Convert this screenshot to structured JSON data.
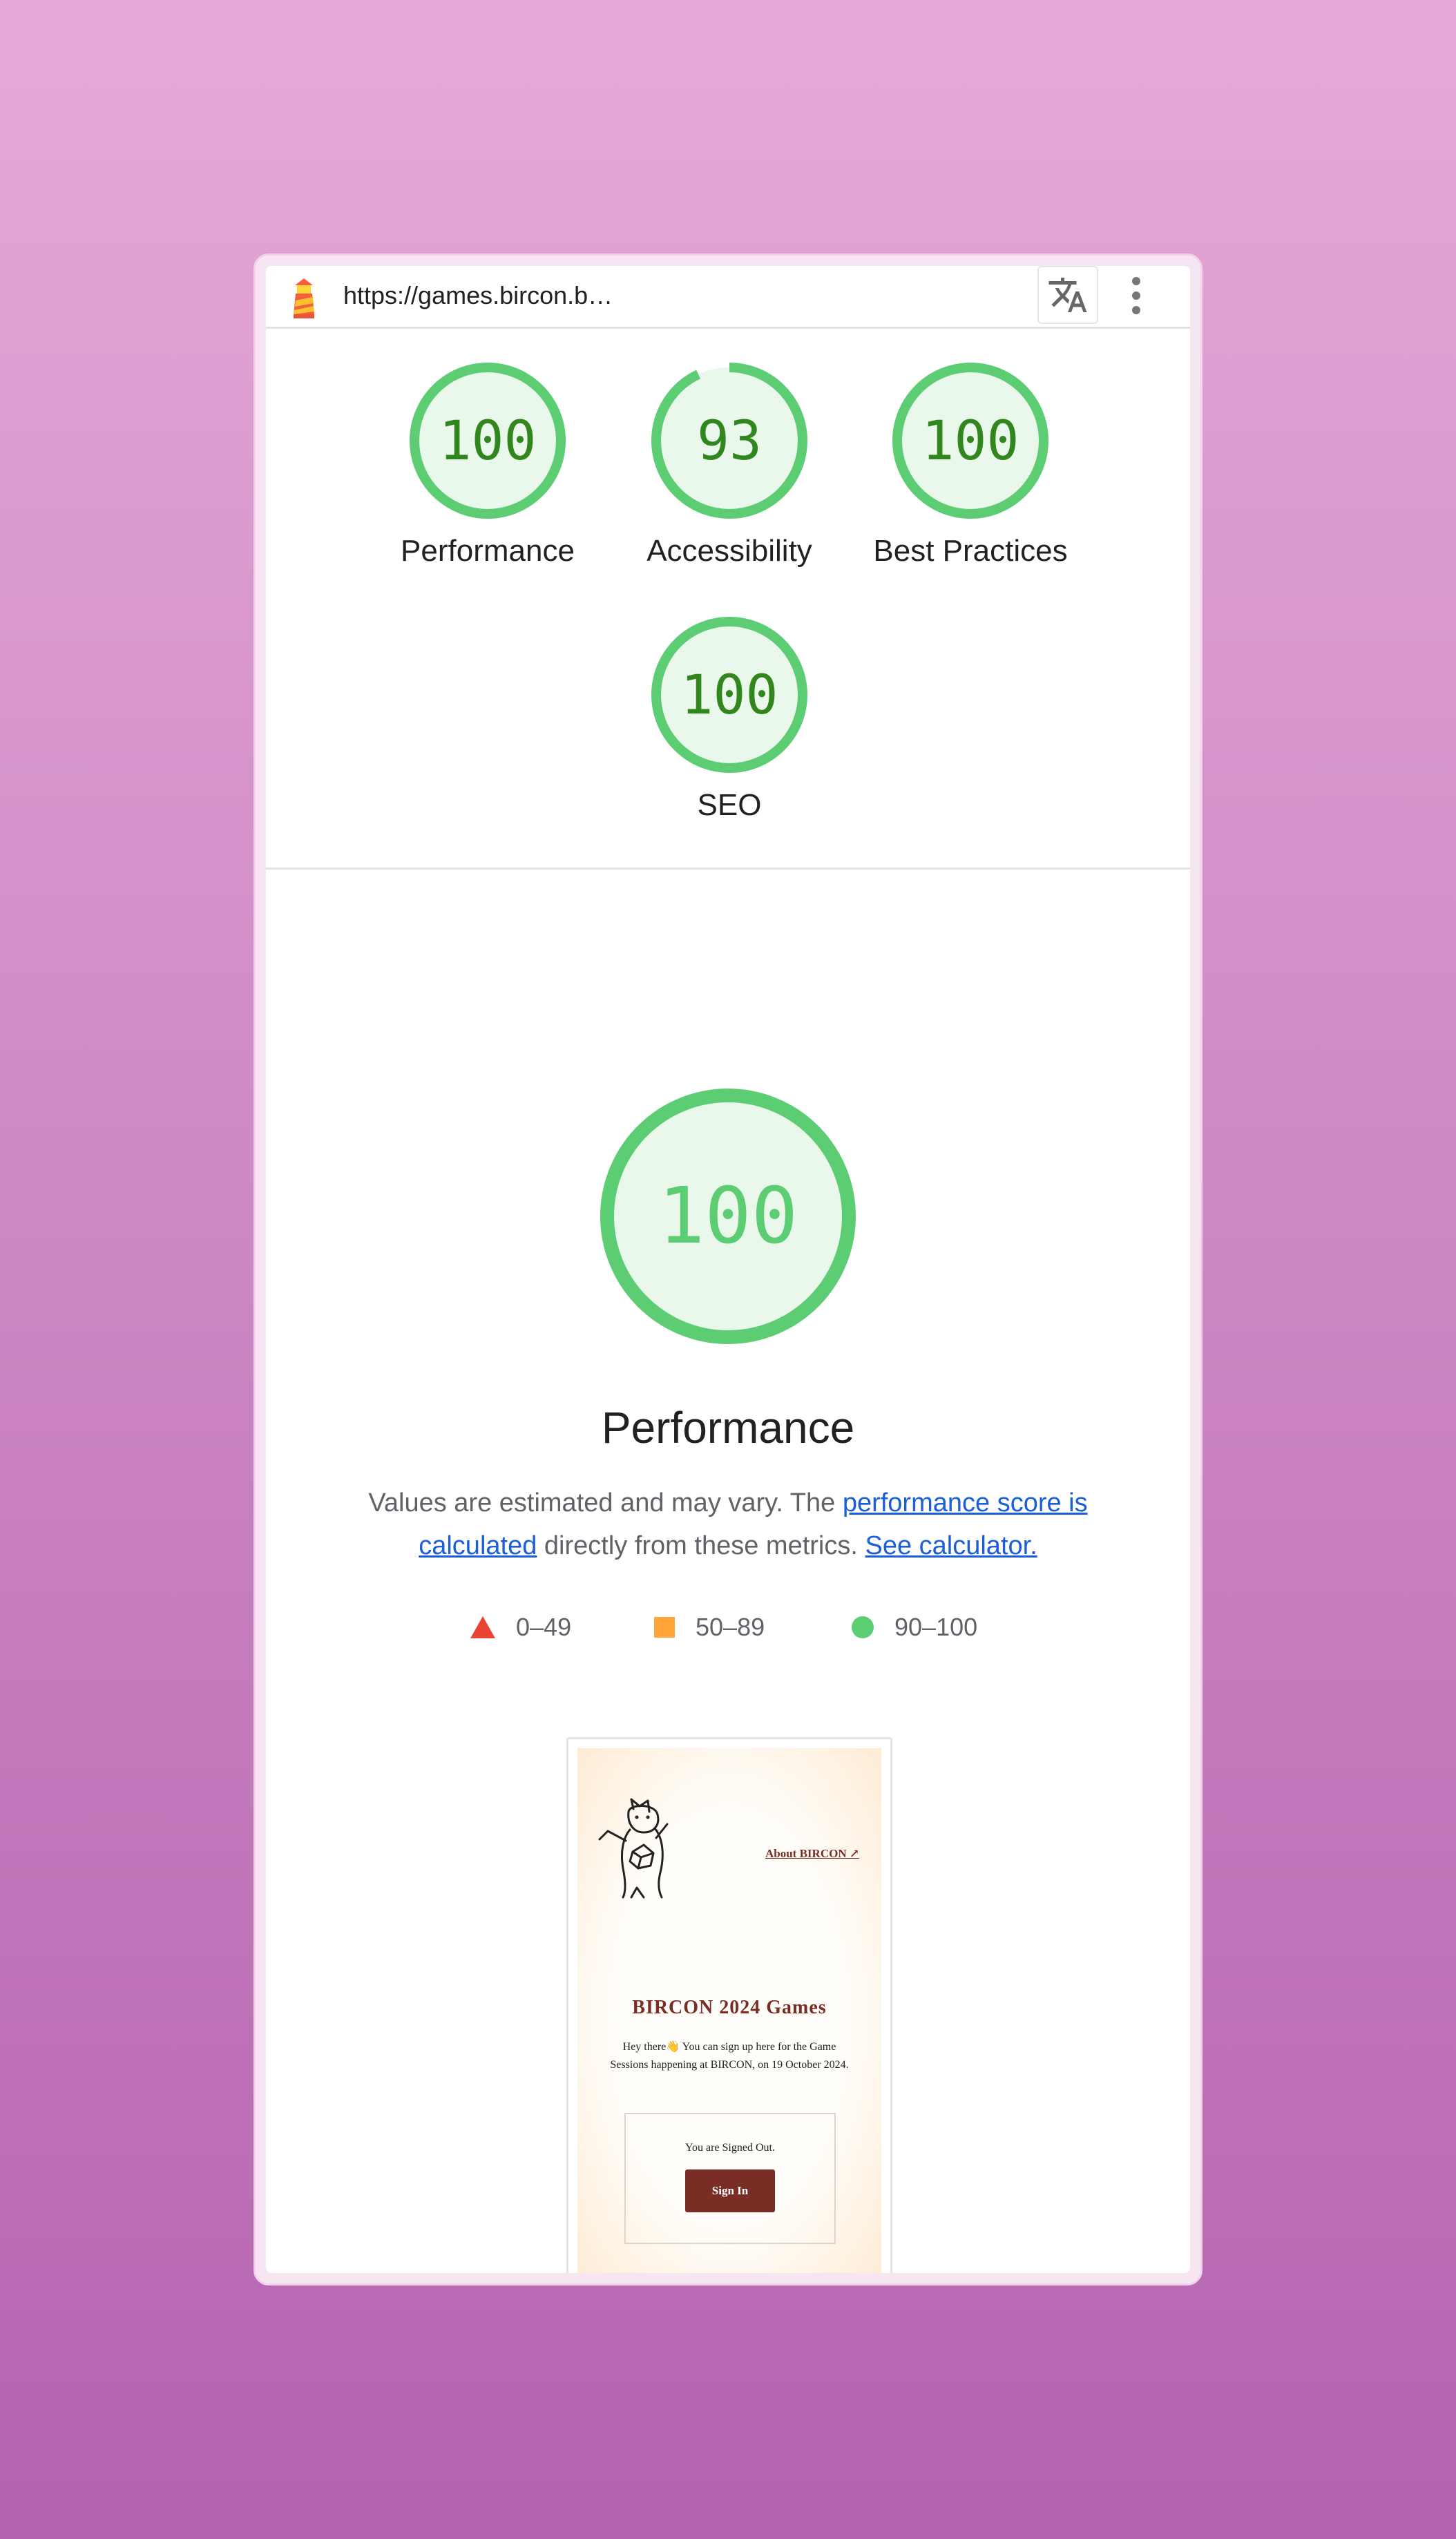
{
  "browser": {
    "url": "https://games.bircon.b…",
    "icons": {
      "logo": "lighthouse-icon",
      "translate": "translate-icon",
      "menu": "kebab-menu-icon"
    }
  },
  "gauges": [
    {
      "label": "Performance",
      "score": "100",
      "fraction": 1.0
    },
    {
      "label": "Accessibility",
      "score": "93",
      "fraction": 0.93
    },
    {
      "label": "Best Practices",
      "score": "100",
      "fraction": 1.0
    },
    {
      "label": "SEO",
      "score": "100",
      "fraction": 1.0
    }
  ],
  "performance": {
    "score": "100",
    "title": "Performance",
    "desc_pre": "Values are estimated and may vary. The ",
    "desc_link1": "performance score is calculated",
    "desc_mid": " directly from these metrics. ",
    "desc_link2": "See calculator."
  },
  "legend": [
    {
      "range": "0–49",
      "shape": "triangle",
      "color": "#eb4333"
    },
    {
      "range": "50–89",
      "shape": "square",
      "color": "#ffa53a"
    },
    {
      "range": "90–100",
      "shape": "circle",
      "color": "#5ccd73"
    }
  ],
  "thumbnail": {
    "about_link": "About BIRCON ↗",
    "title": "BIRCON 2024 Games",
    "body": "Hey there👋 You can sign up here for the Game Sessions happening at BIRCON, on 19 October 2024.",
    "signed_out": "You are Signed Out.",
    "sign_in": "Sign In"
  },
  "colors": {
    "pass": "#5ccd73",
    "pass_text": "#31871e",
    "pass_bg": "#eaf8ec",
    "link": "#1a5fd8",
    "brand_dark_red": "#7a2d25"
  }
}
